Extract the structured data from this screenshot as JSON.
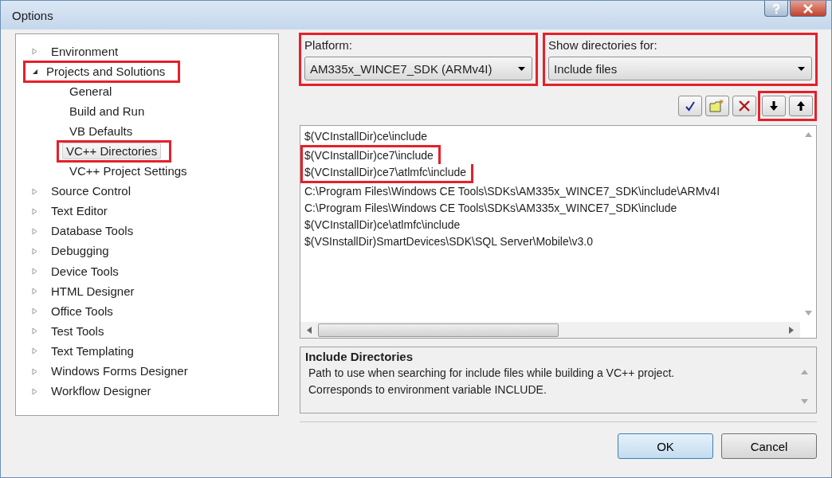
{
  "window": {
    "title": "Options"
  },
  "tree": [
    {
      "label": "Environment",
      "expanded": false,
      "highlighted": false,
      "selected": false
    },
    {
      "label": "Projects and Solutions",
      "expanded": true,
      "highlighted": true,
      "selected": false,
      "children": [
        {
          "label": "General",
          "highlighted": false,
          "selected": false
        },
        {
          "label": "Build and Run",
          "highlighted": false,
          "selected": false
        },
        {
          "label": "VB Defaults",
          "highlighted": false,
          "selected": false
        },
        {
          "label": "VC++ Directories",
          "highlighted": true,
          "selected": true
        },
        {
          "label": "VC++ Project Settings",
          "highlighted": false,
          "selected": false
        }
      ]
    },
    {
      "label": "Source Control",
      "expanded": false,
      "highlighted": false,
      "selected": false
    },
    {
      "label": "Text Editor",
      "expanded": false,
      "highlighted": false,
      "selected": false
    },
    {
      "label": "Database Tools",
      "expanded": false,
      "highlighted": false,
      "selected": false
    },
    {
      "label": "Debugging",
      "expanded": false,
      "highlighted": false,
      "selected": false
    },
    {
      "label": "Device Tools",
      "expanded": false,
      "highlighted": false,
      "selected": false
    },
    {
      "label": "HTML Designer",
      "expanded": false,
      "highlighted": false,
      "selected": false
    },
    {
      "label": "Office Tools",
      "expanded": false,
      "highlighted": false,
      "selected": false
    },
    {
      "label": "Test Tools",
      "expanded": false,
      "highlighted": false,
      "selected": false
    },
    {
      "label": "Text Templating",
      "expanded": false,
      "highlighted": false,
      "selected": false
    },
    {
      "label": "Windows Forms Designer",
      "expanded": false,
      "highlighted": false,
      "selected": false
    },
    {
      "label": "Workflow Designer",
      "expanded": false,
      "highlighted": false,
      "selected": false
    }
  ],
  "platform": {
    "label": "Platform:",
    "value": "AM335x_WINCE7_SDK (ARMv4I)",
    "highlighted": true
  },
  "show_for": {
    "label": "Show directories for:",
    "value": "Include files",
    "highlighted": true
  },
  "toolbar": [
    {
      "kind": "check",
      "highlighted": false
    },
    {
      "kind": "new-folder",
      "highlighted": false
    },
    {
      "kind": "delete",
      "highlighted": false
    },
    {
      "kind": "down",
      "highlighted": true
    },
    {
      "kind": "up",
      "highlighted": true
    }
  ],
  "directories": [
    {
      "path": "$(VCInstallDir)ce\\include",
      "highlighted": false
    },
    {
      "path": "$(VCInstallDir)ce7\\include",
      "highlighted": true
    },
    {
      "path": "$(VCInstallDir)ce7\\atlmfc\\include",
      "highlighted": true
    },
    {
      "path": "C:\\Program Files\\Windows CE Tools\\SDKs\\AM335x_WINCE7_SDK\\include\\ARMv4I",
      "highlighted": false
    },
    {
      "path": "C:\\Program Files\\Windows CE Tools\\SDKs\\AM335x_WINCE7_SDK\\include",
      "highlighted": false
    },
    {
      "path": "$(VCInstallDir)ce\\atlmfc\\include",
      "highlighted": false
    },
    {
      "path": "$(VSInstallDir)SmartDevices\\SDK\\SQL Server\\Mobile\\v3.0",
      "highlighted": false
    }
  ],
  "description": {
    "title": "Include Directories",
    "text": "Path to use when searching for include files while building a VC++ project.\nCorresponds to environment variable INCLUDE."
  },
  "buttons": [
    "OK",
    "Cancel"
  ]
}
